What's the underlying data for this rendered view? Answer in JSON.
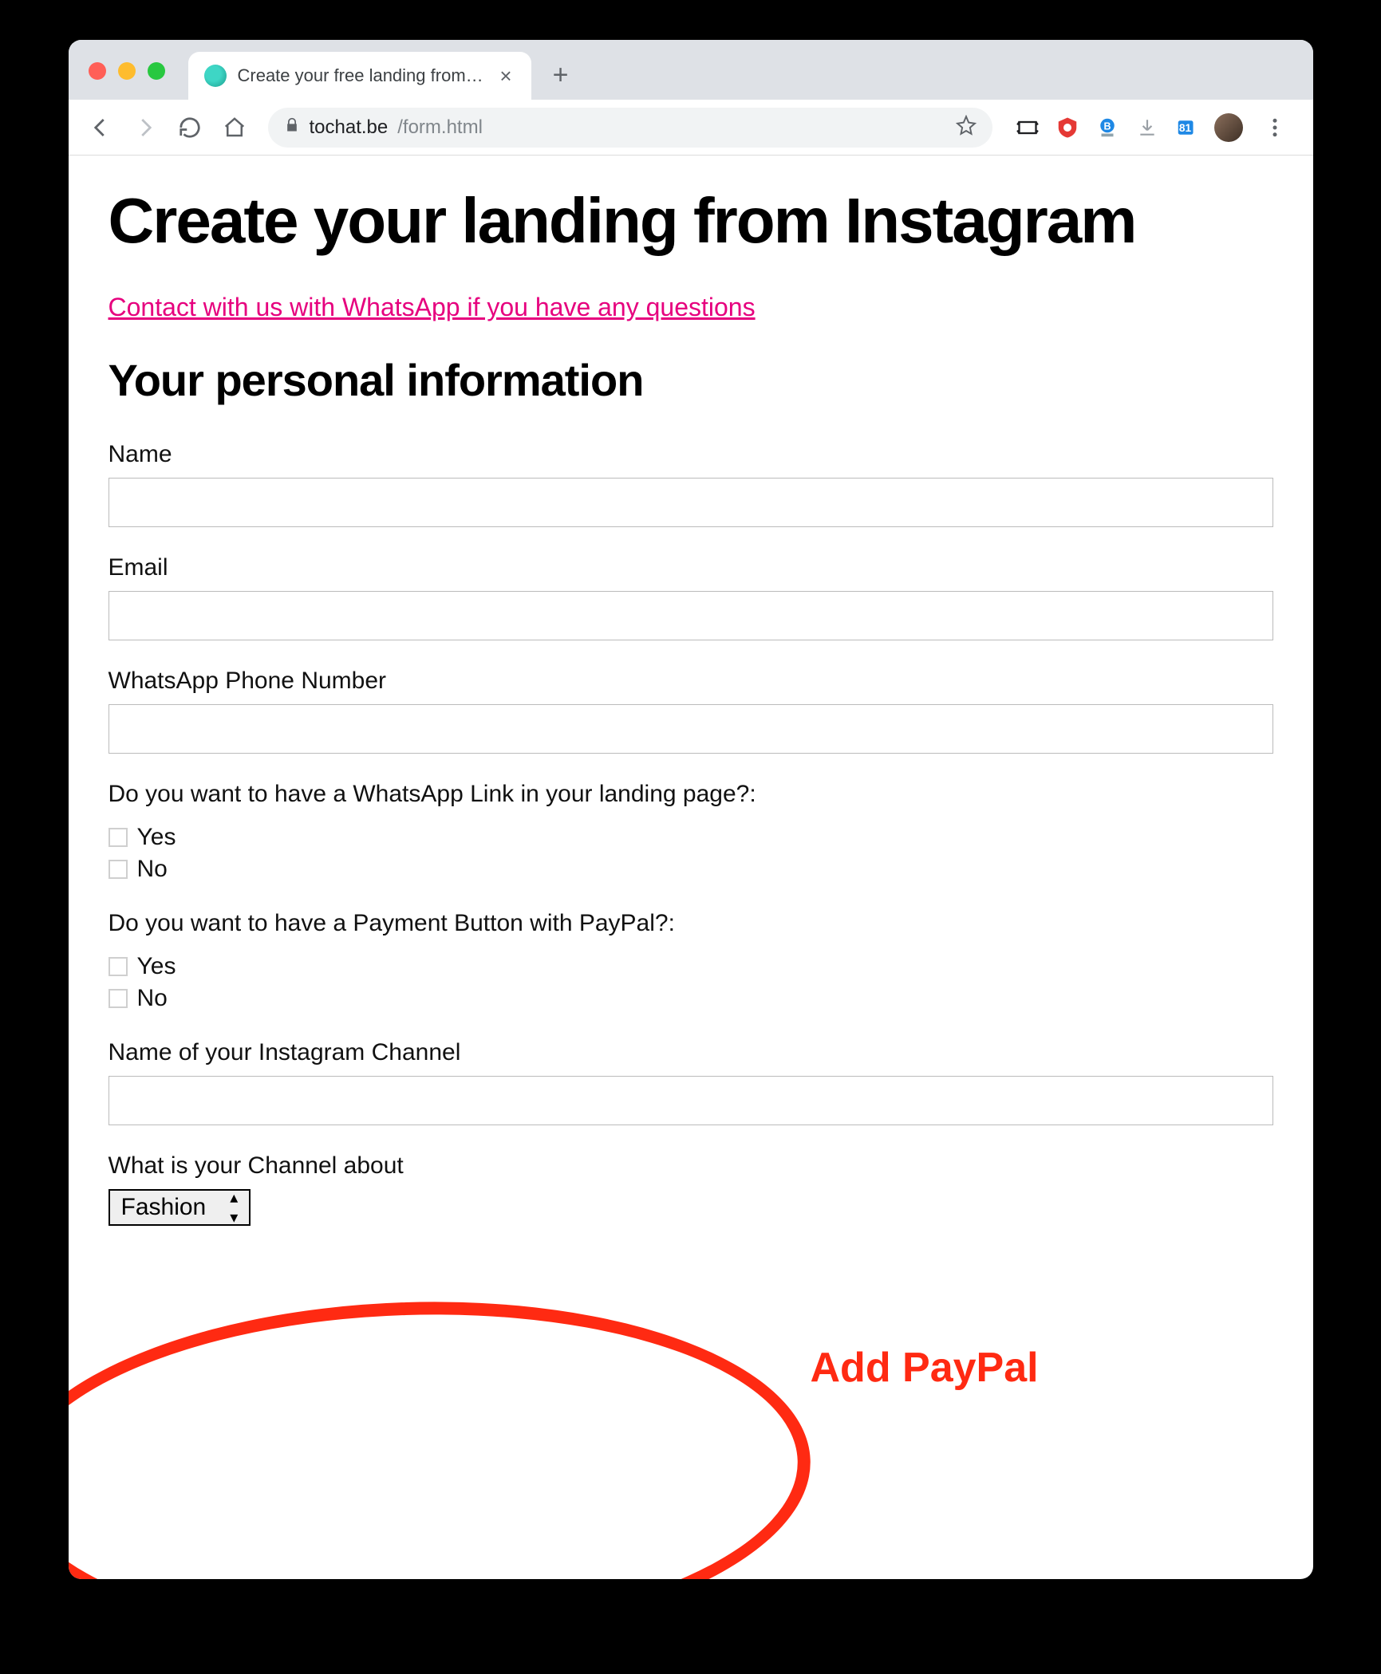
{
  "browser": {
    "tab_title": "Create your free landing from Ins",
    "url_host": "tochat.be",
    "url_path": "/form.html"
  },
  "page": {
    "heading": "Create your landing from Instagram",
    "contact_link": "Contact with us with WhatsApp if you have any questions",
    "section_heading": "Your personal information"
  },
  "form": {
    "name_label": "Name",
    "email_label": "Email",
    "whatsapp_label": "WhatsApp Phone Number",
    "whatsapp_link_question": "Do you want to have a WhatsApp Link in your landing page?:",
    "paypal_question": "Do you want to have a Payment Button with PayPal?:",
    "instagram_channel_label": "Name of your Instagram Channel",
    "channel_about_label": "What is your Channel about",
    "channel_about_value": "Fashion",
    "option_yes": "Yes",
    "option_no": "No"
  },
  "annotation": {
    "text": "Add PayPal"
  }
}
